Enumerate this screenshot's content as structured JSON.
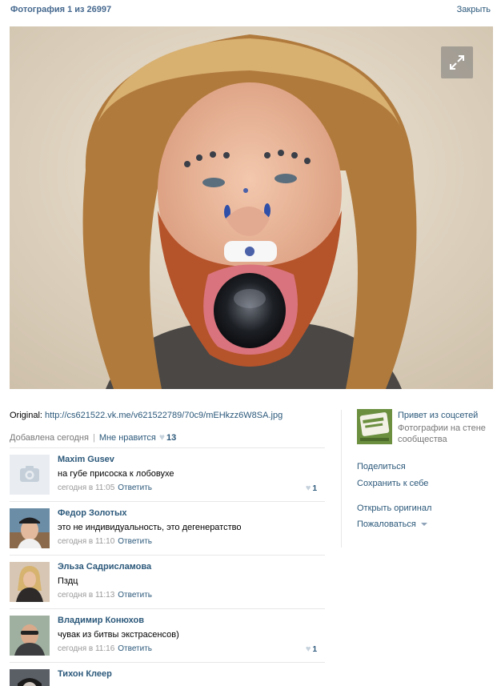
{
  "header": {
    "counter": "Фотография 1 из 26997",
    "close_label": "Закрыть"
  },
  "photo": {
    "expand_icon": "expand-icon"
  },
  "info": {
    "original_label": "Original:",
    "original_url": "http://cs621522.vk.me/v621522789/70c9/mEHkzz6W8SA.jpg",
    "added": "Добавлена сегодня",
    "separator": "|",
    "like_label": "Мне нравится",
    "like_count": "13"
  },
  "comments": [
    {
      "author": "Maxim Gusev",
      "text": "на губе присоска к лобовухе",
      "time": "сегодня в 11:05",
      "reply": "Ответить",
      "likes": "1"
    },
    {
      "author": "Федор Золотых",
      "text": "это не индивидуальность, это дегенератство",
      "time": "сегодня в 11:10",
      "reply": "Ответить",
      "likes": ""
    },
    {
      "author": "Эльза Садрисламова",
      "text": "Пздц",
      "time": "сегодня в 11:13",
      "reply": "Ответить",
      "likes": ""
    },
    {
      "author": "Владимир Конюхов",
      "text": "чувак из битвы экстрасенсов)",
      "time": "сегодня в 11:16",
      "reply": "Ответить",
      "likes": "1"
    },
    {
      "author": "Тихон Клеер",
      "text": "",
      "time": "",
      "reply": "",
      "likes": ""
    }
  ],
  "sidebar": {
    "album_name": "Привет из соцсетей",
    "album_desc": "Фотографии на стене сообщества",
    "share": "Поделиться",
    "save": "Сохранить к себе",
    "open_original": "Открыть оригинал",
    "report": "Пожаловаться"
  },
  "colors": {
    "link": "#2b587a",
    "header": "#45688e",
    "muted": "#777777"
  }
}
